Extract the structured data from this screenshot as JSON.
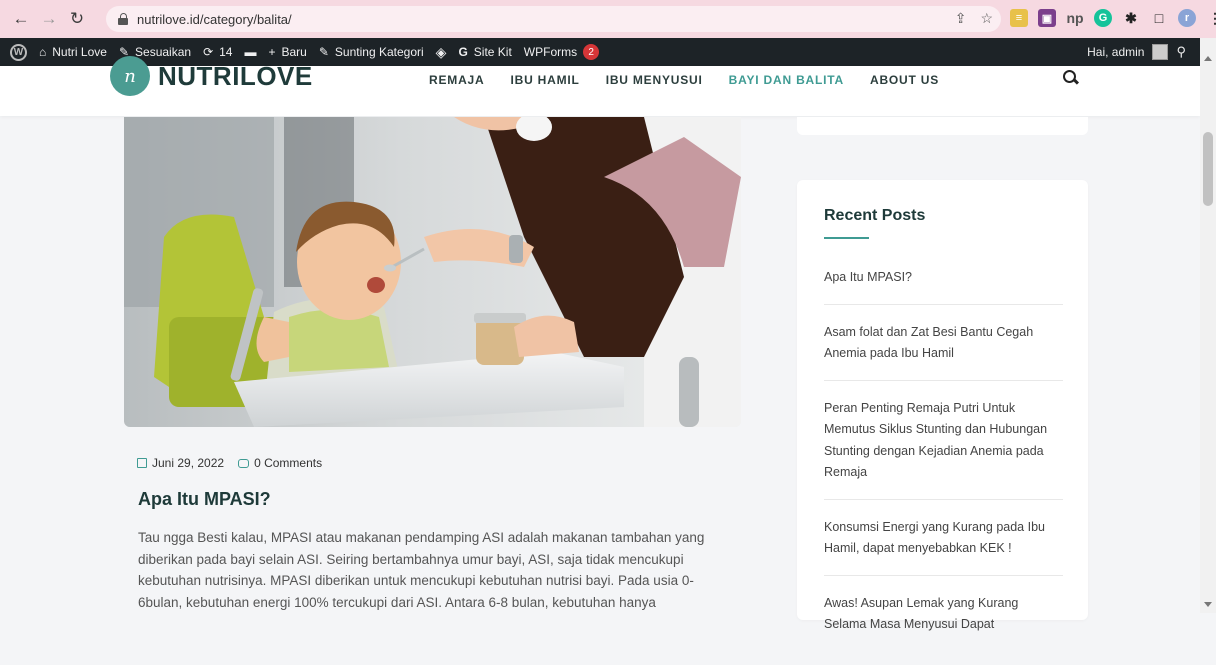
{
  "browser": {
    "url": "nutrilove.id/category/balita/",
    "back_icon": "arrow-left",
    "forward_icon": "arrow-right",
    "reload_icon": "reload",
    "extensions": [
      {
        "name": "notes-extension-icon",
        "color": "#e8c14a",
        "glyph": "≡"
      },
      {
        "name": "bookmark-manager-icon",
        "color": "#7b3f8c",
        "glyph": "▣"
      },
      {
        "name": "np-extension-icon",
        "color": "#555555",
        "glyph": "np"
      },
      {
        "name": "grammarly-icon",
        "color": "#15c39a",
        "glyph": "G"
      },
      {
        "name": "puzzle-icon",
        "color": "#222222",
        "glyph": "✱"
      },
      {
        "name": "sidebar-toggle-icon",
        "color": "#222222",
        "glyph": "□"
      },
      {
        "name": "profile-avatar",
        "color": "#8aa4d6",
        "glyph": "r"
      },
      {
        "name": "menu-kebab-icon",
        "color": "#333333",
        "glyph": "⋮"
      }
    ]
  },
  "wpbar": {
    "site_name": "Nutri Love",
    "customize": "Sesuaikan",
    "updates_count": "14",
    "new_label": "Baru",
    "edit_category": "Sunting Kategori",
    "sitekit": "Site Kit",
    "wpforms": "WPForms",
    "wpforms_badge": "2",
    "greeting": "Hai, admin"
  },
  "site": {
    "logo_text": "NUTRILOVE",
    "logo_mark": "n",
    "menu": [
      {
        "label": "REMAJA",
        "active": false
      },
      {
        "label": "IBU HAMIL",
        "active": false
      },
      {
        "label": "IBU MENYUSUI",
        "active": false
      },
      {
        "label": "BAYI DAN BALITA",
        "active": true
      },
      {
        "label": "ABOUT US",
        "active": false
      }
    ]
  },
  "post": {
    "date": "Juni 29, 2022",
    "comments": "0 Comments",
    "title": "Apa Itu MPASI?",
    "excerpt": "Tau ngga Besti kalau, MPASI atau makanan pendamping ASI adalah makanan tambahan yang diberikan pada bayi selain ASI. Seiring bertambahnya umur bayi, ASI, saja tidak mencukupi kebutuhan nutrisinya. MPASI diberikan untuk mencukupi kebutuhan nutrisi bayi. Pada usia 0-6bulan, kebutuhan energi 100% tercukupi dari ASI. Antara 6-8 bulan, kebutuhan hanya"
  },
  "sidebar": {
    "title": "Recent Posts",
    "posts": [
      "Apa Itu MPASI?",
      "Asam folat dan Zat Besi Bantu Cegah Anemia pada Ibu Hamil",
      "Peran Penting Remaja Putri Untuk Memutus Siklus Stunting dan Hubungan Stunting dengan Kejadian Anemia pada Remaja",
      "Konsumsi Energi yang Kurang pada Ibu Hamil, dapat menyebabkan KEK !",
      "Awas! Asupan Lemak yang Kurang Selama Masa Menyusui Dapat"
    ]
  },
  "colors": {
    "accent": "#3f9b93",
    "chrome": "#f6d9e1",
    "wpbar": "#1d2327",
    "heading": "#1e3a39"
  }
}
